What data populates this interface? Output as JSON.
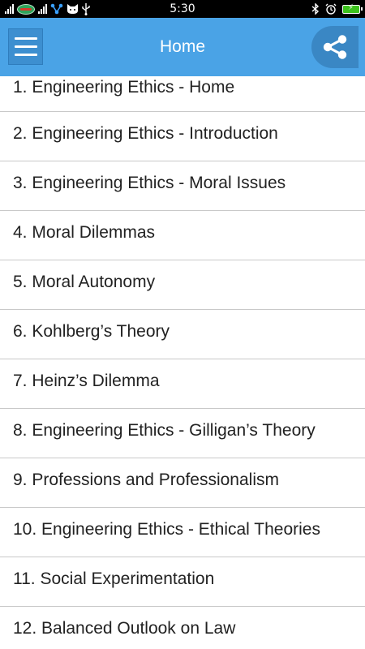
{
  "status_bar": {
    "time": "5:30",
    "icons": [
      "signal-icon",
      "carrier-logo-icon",
      "signal-icon",
      "bluetooth-share-icon",
      "cat-icon",
      "usb-icon",
      "bluetooth-icon",
      "alarm-icon",
      "battery-charging-icon"
    ]
  },
  "app_bar": {
    "title": "Home",
    "menu_icon": "hamburger-menu-icon",
    "share_icon": "share-icon",
    "color": "#4aa3e6"
  },
  "list": {
    "items": [
      {
        "label": "1. Engineering Ethics - Home"
      },
      {
        "label": "2. Engineering Ethics - Introduction"
      },
      {
        "label": "3. Engineering Ethics - Moral Issues"
      },
      {
        "label": "4. Moral Dilemmas"
      },
      {
        "label": "5. Moral Autonomy"
      },
      {
        "label": "6. Kohlberg’s Theory"
      },
      {
        "label": "7. Heinz’s Dilemma"
      },
      {
        "label": "8. Engineering Ethics - Gilligan’s Theory"
      },
      {
        "label": "9. Professions and Professionalism"
      },
      {
        "label": "10. Engineering Ethics - Ethical Theories"
      },
      {
        "label": "11. Social Experimentation"
      },
      {
        "label": "12. Balanced Outlook on Law"
      }
    ]
  }
}
